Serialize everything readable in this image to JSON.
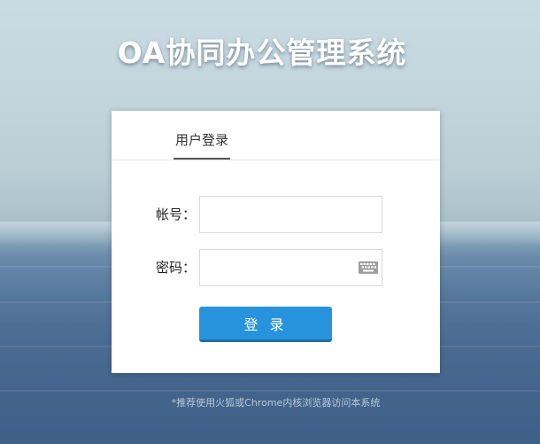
{
  "page": {
    "title": "OA协同办公管理系统",
    "hint": "*推荐使用火狐或Chrome内核浏览器访问本系统"
  },
  "login": {
    "tabs": [
      {
        "label": "用户登录",
        "active": true
      }
    ],
    "account": {
      "label": "帐号：",
      "value": "",
      "placeholder": ""
    },
    "password": {
      "label": "密码：",
      "value": "",
      "placeholder": "",
      "icon": "keyboard-icon"
    },
    "submit_label": "登 录"
  },
  "colors": {
    "primary_button": "#2793dc",
    "title_text": "#ffffff",
    "hint_text": "#b9c7d4"
  }
}
